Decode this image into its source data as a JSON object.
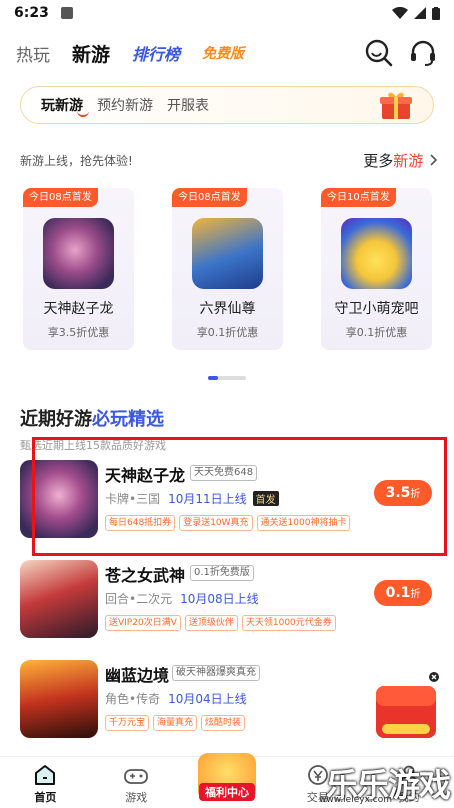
{
  "status": {
    "time": "6:23"
  },
  "topnav": {
    "tabs": [
      "热玩",
      "新游",
      "排行榜",
      "免费版"
    ]
  },
  "subtabs": [
    "玩新游",
    "预约新游",
    "开服表"
  ],
  "section": {
    "left": "新游上线，抢先体验!",
    "more_prefix": "更多",
    "more_highlight": "新游"
  },
  "cards": [
    {
      "tag": "今日08点首发",
      "name": "天神赵子龙",
      "desc": "享3.5折优惠"
    },
    {
      "tag": "今日08点首发",
      "name": "六界仙尊",
      "desc": "享0.1折优惠"
    },
    {
      "tag": "今日10点首发",
      "name": "守卫小萌宠吧",
      "desc": "享0.1折优惠"
    }
  ],
  "recent": {
    "title_prefix": "近期好游",
    "title_highlight": "必玩精选",
    "subtitle": "甄选近期上线15款品质好游戏"
  },
  "games": [
    {
      "name": "天神赵子龙",
      "badge": "天天免费648",
      "genre": "卡牌•三国",
      "date": "10月11日上线",
      "first": "首发",
      "chips": [
        "每日648抵扣券",
        "登录送10W真充",
        "通关送1000神将抽卡"
      ],
      "discount": "3.5",
      "unit": "折"
    },
    {
      "name": "苍之女武神",
      "badge": "0.1折免费版",
      "genre": "回合•二次元",
      "date": "10月08日上线",
      "first": "",
      "chips": [
        "送VIP20次日满V",
        "送顶级伙伴",
        "天天领1000元代金券"
      ],
      "discount": "0.1",
      "unit": "折"
    },
    {
      "name": "幽蓝边境",
      "badge": "破天神器爆爽真充",
      "genre": "角色•传奇",
      "date": "10月04日上线",
      "first": "",
      "chips": [
        "千万元宝",
        "海量真充",
        "炫酷时装"
      ],
      "discount": "",
      "unit": ""
    }
  ],
  "tabbar": [
    "首页",
    "游戏",
    "福利中心",
    "交易",
    "我的"
  ],
  "watermark": {
    "main": "乐乐游戏",
    "url": "www.leleyx.com"
  },
  "colors": {
    "accent": "#3c57e0",
    "brand": "#ff5a2a",
    "highlight_box": "#e8141a"
  }
}
